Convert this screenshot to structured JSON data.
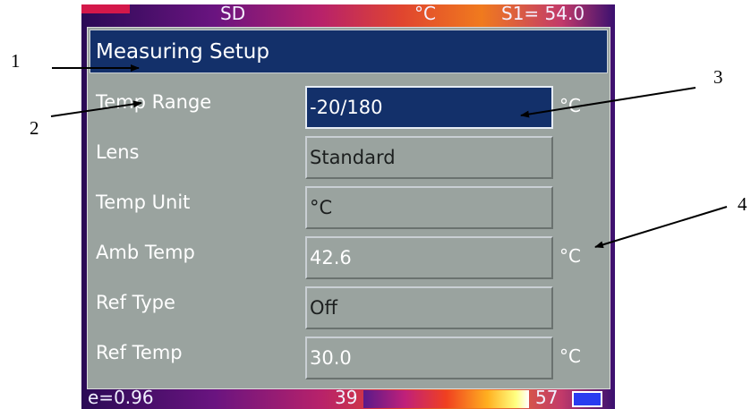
{
  "status_bar": {
    "storage": "SD",
    "unit": "°C",
    "spot": "S1= 54.0"
  },
  "dialog": {
    "title": "Measuring Setup",
    "rows": [
      {
        "label": "Temp Range",
        "value": "-20/180",
        "unit": "°C",
        "state": "selected"
      },
      {
        "label": "Lens",
        "value": "Standard",
        "unit": "",
        "state": "editable"
      },
      {
        "label": "Temp Unit",
        "value": "°C",
        "unit": "",
        "state": "editable"
      },
      {
        "label": "Amb Temp",
        "value": "42.6",
        "unit": "°C",
        "state": "value"
      },
      {
        "label": "Ref Type",
        "value": "Off",
        "unit": "",
        "state": "editable"
      },
      {
        "label": "Ref Temp",
        "value": "30.0",
        "unit": "°C",
        "state": "value"
      }
    ]
  },
  "bottom_bar": {
    "emissivity": "e=0.96",
    "palette_min": "39",
    "palette_max": "57"
  },
  "callouts": [
    "1",
    "2",
    "3",
    "4"
  ],
  "colors": {
    "title_bg": "#13306a",
    "panel_bg": "#9aa39f",
    "selected_bg": "#13306a"
  }
}
